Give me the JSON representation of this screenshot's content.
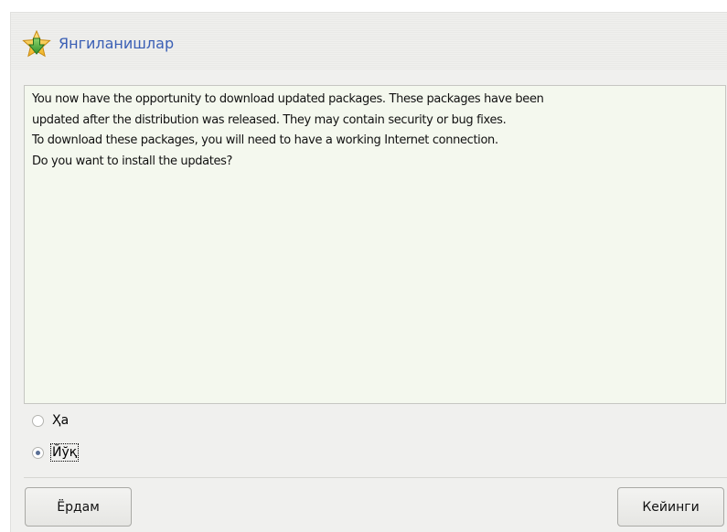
{
  "header": {
    "title": "Янгиланишлар",
    "icon": "star-download-icon"
  },
  "message": {
    "lines": [
      "You now have the opportunity to download updated packages. These packages have been",
      "updated after the distribution was released. They may contain security or bug fixes.",
      "To download these packages, you will need to have a working Internet connection.",
      "Do you want to install the updates?"
    ]
  },
  "options": {
    "yes_label": "Ҳа",
    "no_label": "Йўқ",
    "selected": "no"
  },
  "buttons": {
    "help_label": "Ёрдам",
    "next_label": "Кейинги"
  },
  "colors": {
    "title": "#3a5fb5",
    "textbox_bg": "#f4f8ee",
    "window_bg": "#f0f0ee",
    "star": "#f2c12e",
    "arrow": "#4aa83a"
  }
}
